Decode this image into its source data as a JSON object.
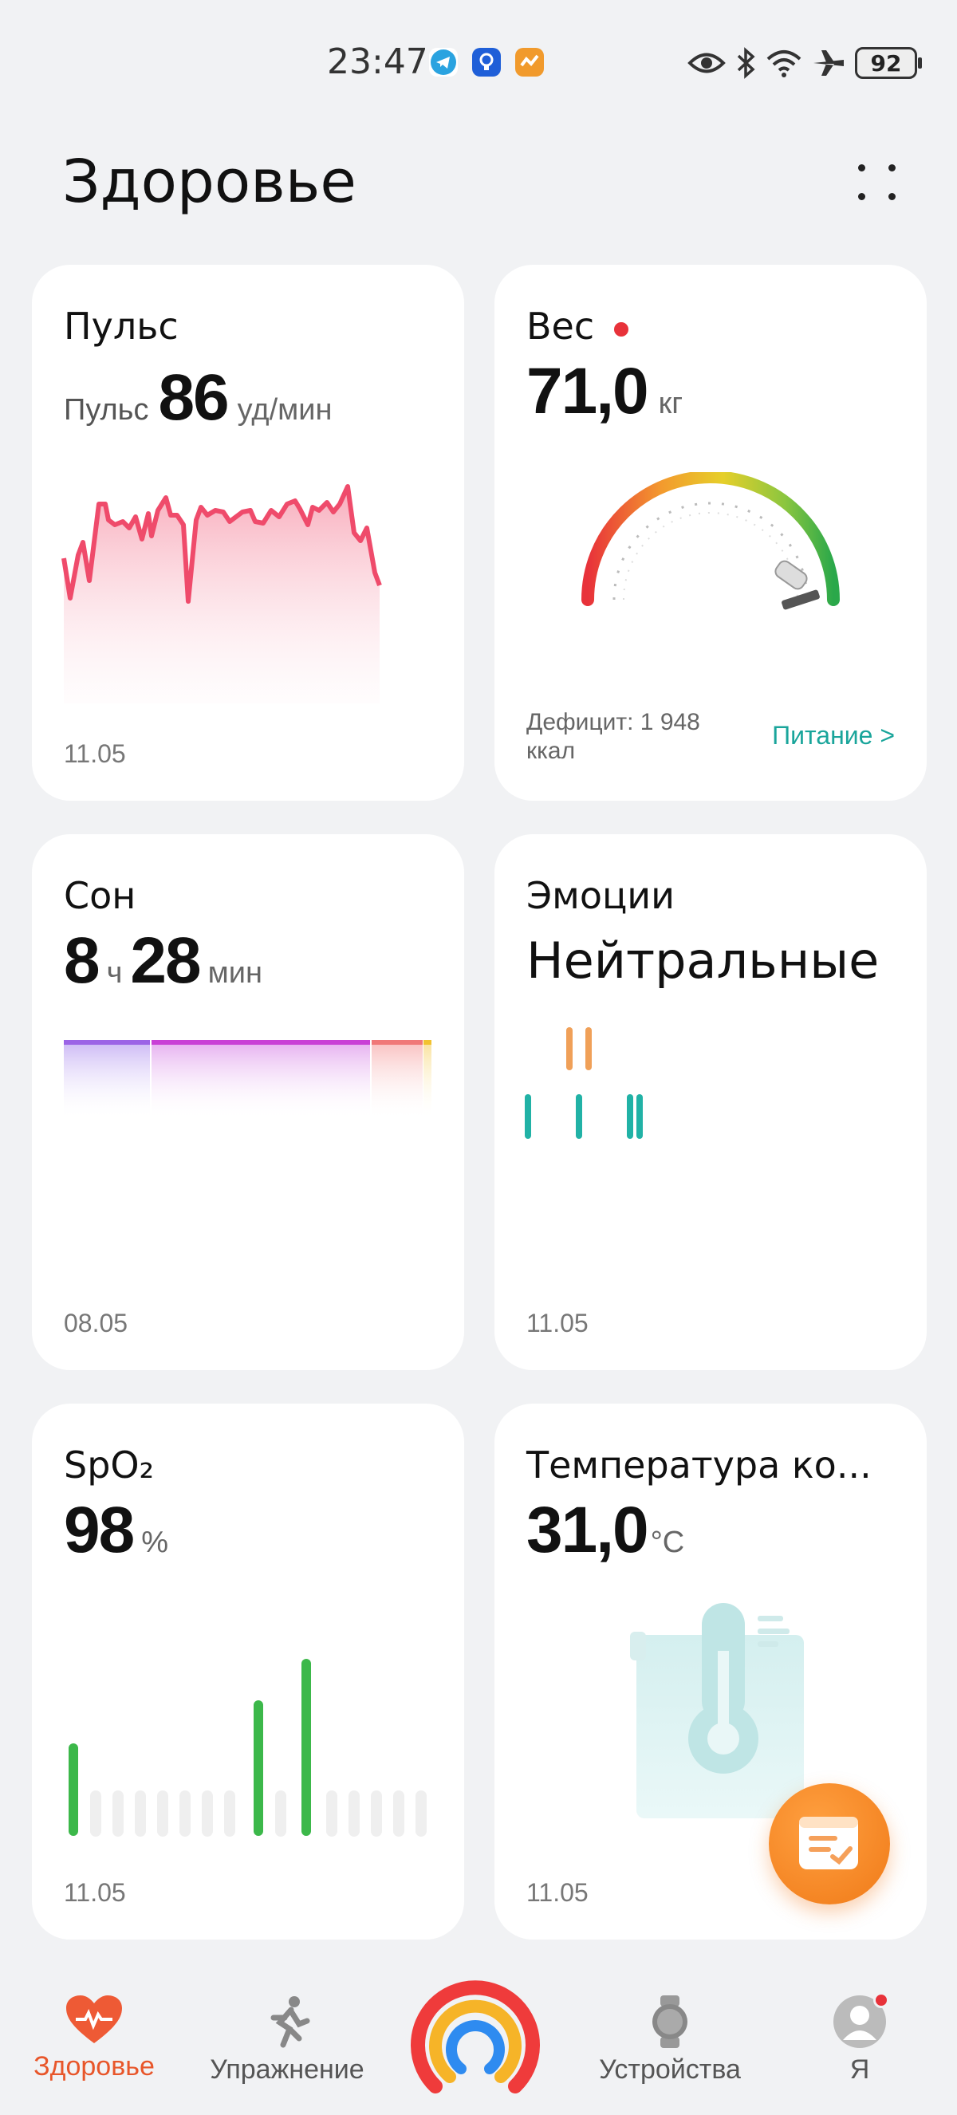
{
  "status": {
    "time": "23:47",
    "battery": "92"
  },
  "page": {
    "title": "Здоровье"
  },
  "cards": {
    "pulse": {
      "title": "Пульс",
      "label": "Пульс",
      "value": "86",
      "unit": "уд/мин",
      "date": "11.05"
    },
    "weight": {
      "title": "Вес",
      "value": "71,0",
      "unit": "кг",
      "deficit": "Дефицит: 1 948",
      "deficit_unit": "ккал",
      "link": "Питание >"
    },
    "sleep": {
      "title": "Сон",
      "hours": "8",
      "hours_unit": "ч",
      "minutes": "28",
      "minutes_unit": "мин",
      "date": "08.05"
    },
    "emotion": {
      "title": "Эмоции",
      "value": "Нейтральные",
      "date": "11.05"
    },
    "spo2": {
      "title": "SpO₂",
      "value": "98",
      "unit": "%",
      "date": "11.05"
    },
    "temperature": {
      "title": "Температура ко...",
      "value": "31,0",
      "unit": "°C",
      "date": "11.05"
    }
  },
  "nav": {
    "items": [
      {
        "label": "Здоровье",
        "active": true
      },
      {
        "label": "Упражнение",
        "active": false
      },
      {
        "label": "Устройства",
        "active": false
      },
      {
        "label": "Я",
        "active": false
      }
    ]
  },
  "colors": {
    "accent": "#e8562a",
    "teal": "#1aa59b",
    "pulse": "#ef4b6b",
    "spo2": "#3cb84a"
  }
}
